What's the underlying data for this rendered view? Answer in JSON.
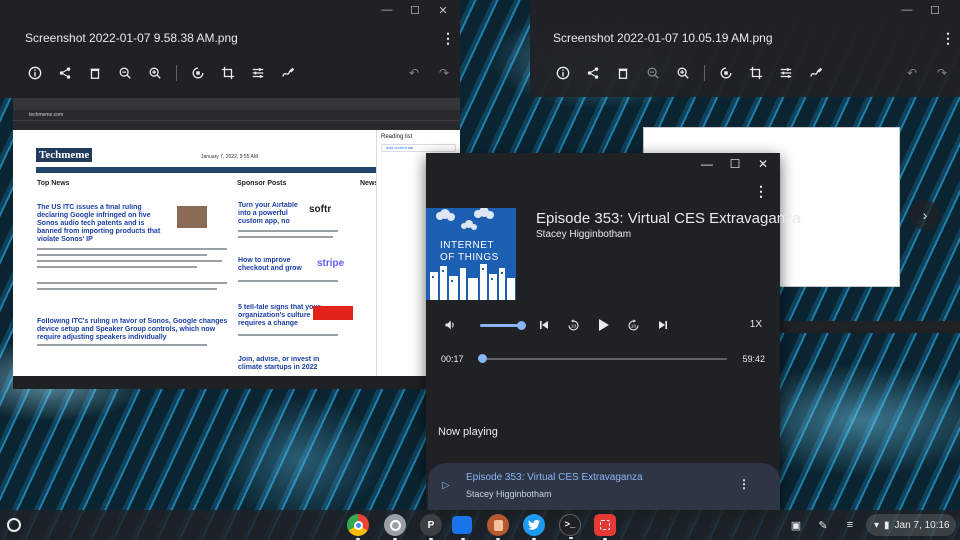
{
  "viewers": {
    "left": {
      "title": "Screenshot 2022-01-07 9.58.38 AM.png"
    },
    "right": {
      "title": "Screenshot 2022-01-07 10.05.19 AM.png"
    }
  },
  "left_screenshot": {
    "url": "techmeme.com",
    "date": "January 7, 2022, 9:55 AM",
    "logo": "Techmeme",
    "top_news_header": "Top News",
    "sponsor_header": "Sponsor Posts",
    "news_header": "News",
    "headline_1": "The US ITC issues a final ruling declaring Google infringed on five Sonos audio tech patents and is banned from importing products that violate Sonos' IP",
    "headline_2": "Following ITC's ruling in favor of Sonos, Google changes device setup and Speaker Group controls, which now require adjusting speakers individually",
    "sponsor_1": "Turn your Airtable into a powerful custom app, no code required",
    "sponsor_2": "How to improve checkout and grow sales",
    "sponsor_3": "5 tell-tale signs that your organization's culture requires a change",
    "sponsor_4": "Join, advise, or invest in climate startups in 2022",
    "reading_list_title": "Reading list",
    "reading_list_add": "Add current tab"
  },
  "player": {
    "episode_title": "Episode 353: Virtual CES Extravaganza",
    "author": "Stacey Higginbotham",
    "artwork_text": [
      "INTERNET",
      "OF THINGS"
    ],
    "current_time": "00:17",
    "duration": "59:42",
    "progress_fraction": 0.005,
    "volume_fraction": 0.9,
    "speed": "1X",
    "now_playing_label": "Now playing",
    "accent_color": "#8ab4f8"
  },
  "shelf": {
    "apps": [
      "chrome-app",
      "files-app",
      "p-app",
      "documents-app",
      "ublock-app",
      "twitter-app",
      "terminal-app",
      "screenshot-app"
    ],
    "p_app_letter": "P",
    "clock": "Jan 7, 10:16"
  }
}
